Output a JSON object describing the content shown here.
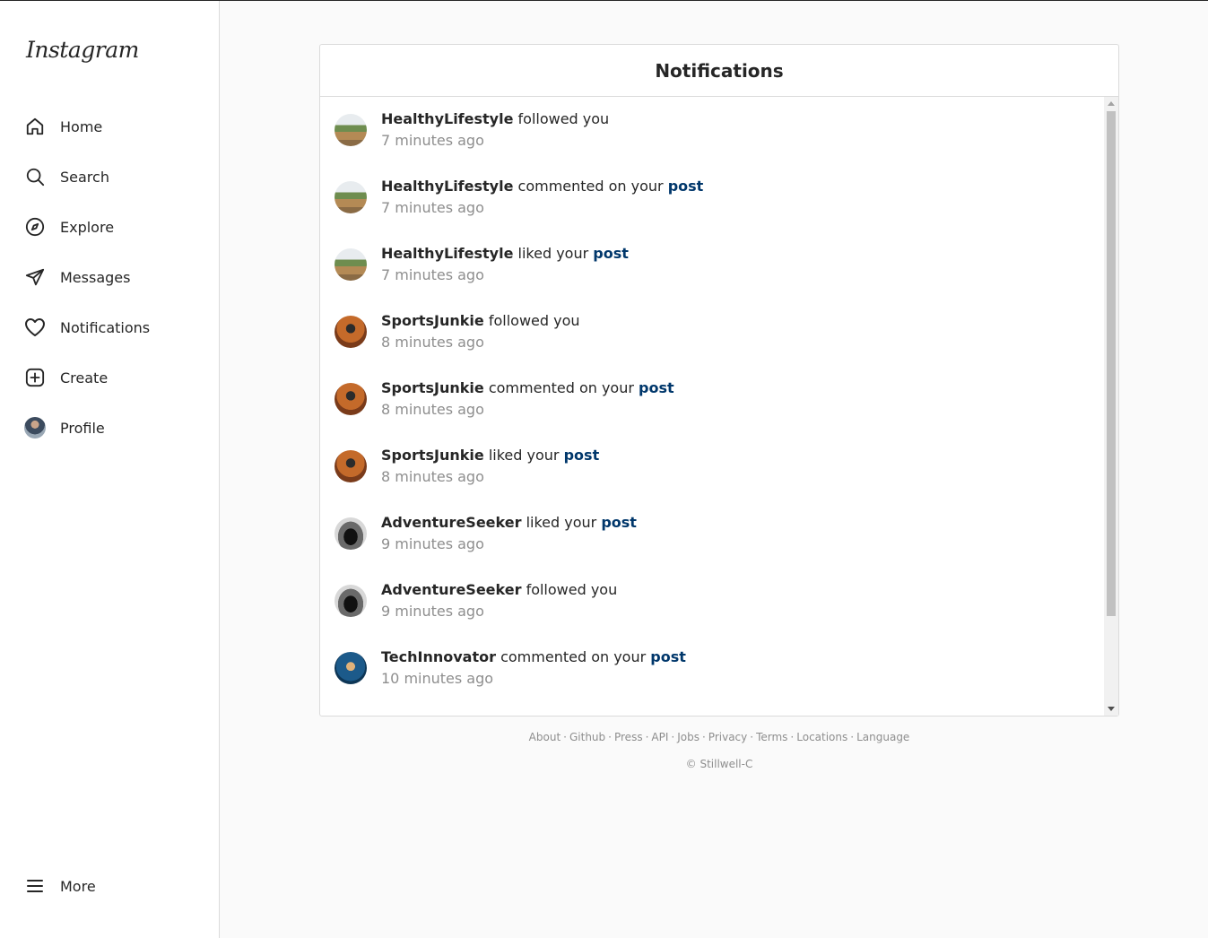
{
  "app": {
    "logo_text": "Instagram"
  },
  "sidebar": {
    "items": [
      {
        "label": "Home",
        "icon": "home-icon"
      },
      {
        "label": "Search",
        "icon": "search-icon"
      },
      {
        "label": "Explore",
        "icon": "compass-icon"
      },
      {
        "label": "Messages",
        "icon": "paper-plane-icon"
      },
      {
        "label": "Notifications",
        "icon": "heart-icon"
      },
      {
        "label": "Create",
        "icon": "plus-square-icon"
      },
      {
        "label": "Profile",
        "icon": "avatar"
      }
    ],
    "more_label": "More"
  },
  "notifications": {
    "title": "Notifications",
    "items": [
      {
        "user": "HealthyLifestyle",
        "action": "followed you",
        "link": "",
        "time": "7 minutes ago"
      },
      {
        "user": "HealthyLifestyle",
        "action": "commented on your",
        "link": "post",
        "time": "7 minutes ago"
      },
      {
        "user": "HealthyLifestyle",
        "action": "liked your",
        "link": "post",
        "time": "7 minutes ago"
      },
      {
        "user": "SportsJunkie",
        "action": "followed you",
        "link": "",
        "time": "8 minutes ago"
      },
      {
        "user": "SportsJunkie",
        "action": "commented on your",
        "link": "post",
        "time": "8 minutes ago"
      },
      {
        "user": "SportsJunkie",
        "action": "liked your",
        "link": "post",
        "time": "8 minutes ago"
      },
      {
        "user": "AdventureSeeker",
        "action": "liked your",
        "link": "post",
        "time": "9 minutes ago"
      },
      {
        "user": "AdventureSeeker",
        "action": "followed you",
        "link": "",
        "time": "9 minutes ago"
      },
      {
        "user": "TechInnovator",
        "action": "commented on your",
        "link": "post",
        "time": "10 minutes ago"
      }
    ]
  },
  "footer": {
    "links": [
      "About",
      "Github",
      "Press",
      "API",
      "Jobs",
      "Privacy",
      "Terms",
      "Locations",
      "Language"
    ],
    "separator": "·",
    "copyright": "© Stillwell-C"
  },
  "colors": {
    "link": "#00376b",
    "muted": "#8e8e8e",
    "border": "#dbdbdb",
    "background": "#fafafa"
  }
}
